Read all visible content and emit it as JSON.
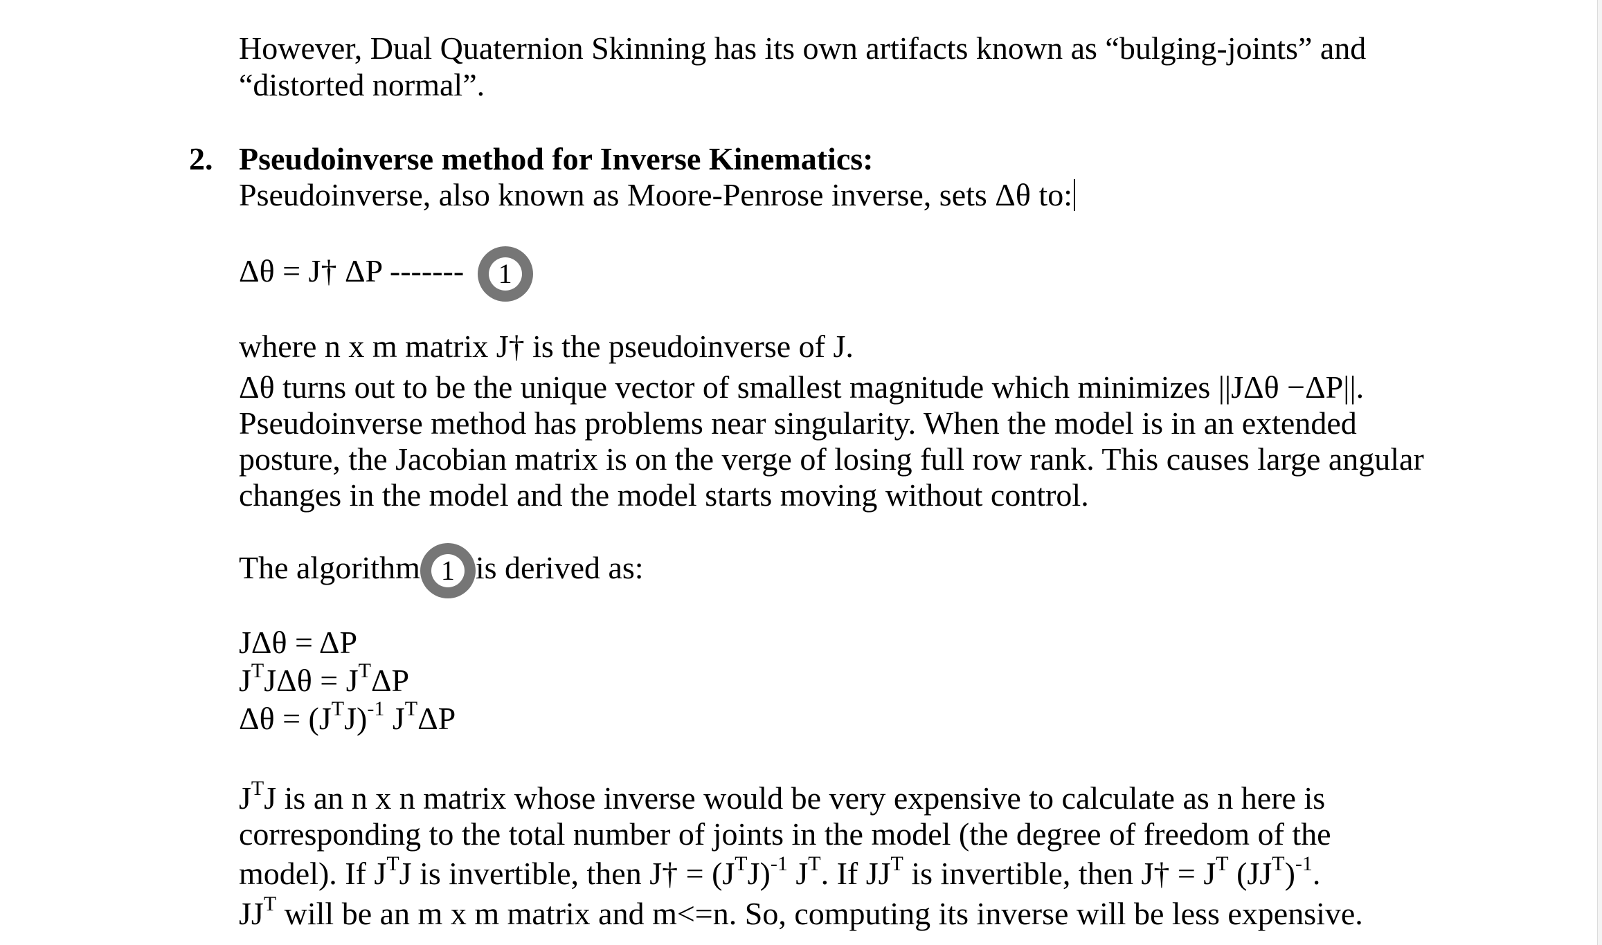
{
  "document": {
    "intro_line1": "However, Dual Quaternion Skinning has its own artifacts known as “bulging-joints” and",
    "intro_line2": "“distorted normal”.",
    "section_number": "2.",
    "section_title": "Pseudoinverse method for Inverse Kinematics:",
    "def_line": "Pseudoinverse, also known as Moore-Penrose inverse, sets Δθ to:",
    "equation_main": "Δθ = J† ΔP  -------",
    "eq_ref_label": "1",
    "para1": [
      "where n x m matrix J† is the pseudoinverse of J.",
      "Δθ turns out to be the unique vector of smallest magnitude which minimizes ||JΔθ −ΔP||.",
      "Pseudoinverse method has problems near singularity. When the model is in an extended",
      "posture, the Jacobian matrix is on the verge of losing full row rank. This causes large angular",
      "changes in the model and the model starts moving without control."
    ],
    "algo_before": "The algorithm",
    "algo_after": "is derived as:",
    "derivation": {
      "eq1": "JΔθ = ΔP",
      "eq2_a": "J",
      "eq2_b": "JΔθ = J",
      "eq2_c": "ΔP",
      "eq3_a": "Δθ = (J",
      "eq3_b": "J)",
      "eq3_c": " J",
      "eq3_d": "ΔP",
      "sup_T": "T",
      "sup_inv": "-1"
    },
    "para2": {
      "l1_a": "J",
      "l1_b": "J is an n x n matrix whose inverse would be very expensive to calculate as n here is",
      "l2": "corresponding to the total number of joints in the model (the degree of freedom of the",
      "l3_a": "model). If J",
      "l3_b": "J is invertible, then J† = (J",
      "l3_c": "J)",
      "l3_d": " J",
      "l3_e": ". If JJ",
      "l3_f": " is invertible, then J† = J",
      "l3_g": " (JJ",
      "l3_h": ")",
      "l3_i": ".",
      "l4_a": "JJ",
      "l4_b": " will be an m x m matrix and m<=n. So, computing its inverse will be less expensive."
    }
  }
}
